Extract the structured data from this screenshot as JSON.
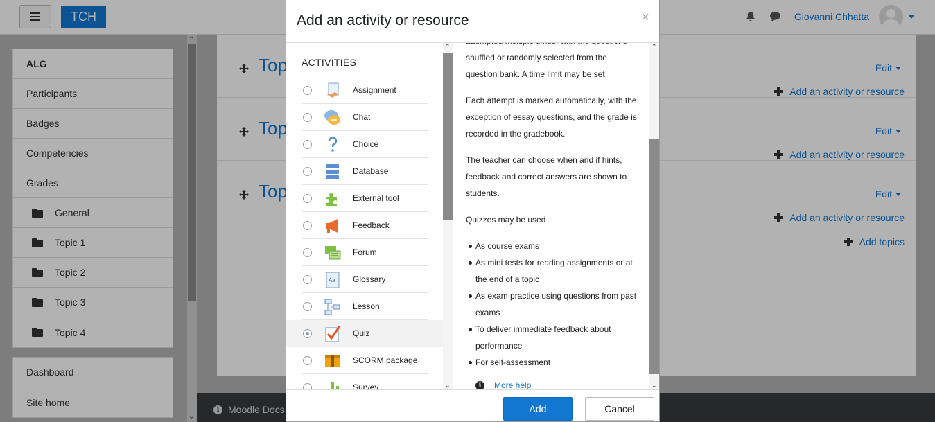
{
  "header": {
    "brand": "TCH",
    "user_name": "Giovanni Chhatta"
  },
  "nav": {
    "items": [
      {
        "label": "ALG"
      },
      {
        "label": "Participants"
      },
      {
        "label": "Badges"
      },
      {
        "label": "Competencies"
      },
      {
        "label": "Grades"
      },
      {
        "label": "General"
      },
      {
        "label": "Topic 1"
      },
      {
        "label": "Topic 2"
      },
      {
        "label": "Topic 3"
      },
      {
        "label": "Topic 4"
      }
    ],
    "secondary": [
      {
        "label": "Dashboard"
      },
      {
        "label": "Site home"
      }
    ]
  },
  "content": {
    "topics": [
      {
        "title": "Top",
        "edit": "Edit",
        "add": "Add an activity or resource"
      },
      {
        "title": "Top",
        "edit": "Edit",
        "add": "Add an activity or resource"
      },
      {
        "title": "Top",
        "edit": "Edit",
        "add": "Add an activity or resource"
      }
    ],
    "add_topics": "Add topics"
  },
  "footer": {
    "docs_link": "Moodle Docs"
  },
  "modal": {
    "title": "Add an activity or resource",
    "close": "×",
    "heading": "ACTIVITIES",
    "options": [
      {
        "label": "Assignment",
        "icon": "assignment-icon"
      },
      {
        "label": "Chat",
        "icon": "chat-icon"
      },
      {
        "label": "Choice",
        "icon": "choice-icon"
      },
      {
        "label": "Database",
        "icon": "database-icon"
      },
      {
        "label": "External tool",
        "icon": "external-tool-icon"
      },
      {
        "label": "Feedback",
        "icon": "feedback-icon"
      },
      {
        "label": "Forum",
        "icon": "forum-icon"
      },
      {
        "label": "Glossary",
        "icon": "glossary-icon"
      },
      {
        "label": "Lesson",
        "icon": "lesson-icon"
      },
      {
        "label": "Quiz",
        "icon": "quiz-icon"
      },
      {
        "label": "SCORM package",
        "icon": "scorm-icon"
      },
      {
        "label": "Survey",
        "icon": "survey-icon"
      }
    ],
    "selected": "Quiz",
    "description": {
      "p0": "attempted multiple times, with the questions shuffled or randomly selected from the question bank. A time limit may be set.",
      "p1": "Each attempt is marked automatically, with the exception of essay questions, and the grade is recorded in the gradebook.",
      "p2": "The teacher can choose when and if hints, feedback and correct answers are shown to students.",
      "p3": "Quizzes may be used",
      "uses": [
        "As course exams",
        "As mini tests for reading assignments or at the end of a topic",
        "As exam practice using questions from past exams",
        "To deliver immediate feedback about performance",
        "For self-assessment"
      ],
      "more_help": "More help"
    },
    "buttons": {
      "add": "Add",
      "cancel": "Cancel"
    }
  }
}
